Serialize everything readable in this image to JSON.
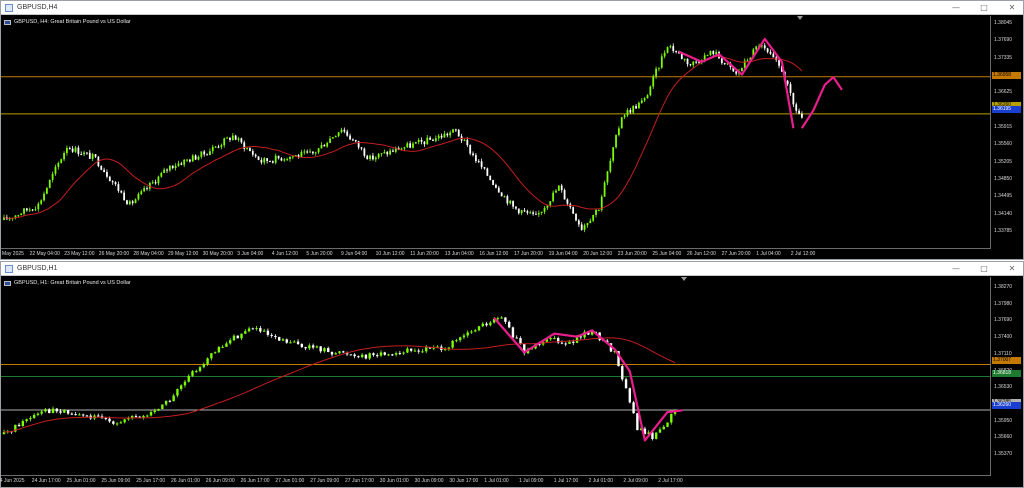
{
  "colors": {
    "bull": "#7CFC00",
    "bear": "#FFFFFF",
    "ma": "#C41E1E",
    "forecast": "#E91E8C",
    "hline_orange": "#C47A00",
    "hline_yellow": "#B8A000",
    "hline_green": "#1E7A2E",
    "hline_grey": "#B0B0B0"
  },
  "windows": [
    {
      "id": "h4",
      "title": "GBPUSD,H4",
      "label": "GBPUSD, H4:  Great Britain Pound vs US Dollar",
      "window_buttons": [
        "—",
        "□",
        "✕"
      ],
      "y_ticks": [
        "1.38045",
        "1.37690",
        "1.37335",
        "1.36980",
        "1.36625",
        "1.36270",
        "1.35915",
        "1.35560",
        "1.35205",
        "1.34850",
        "1.34495",
        "1.34140",
        "1.33785"
      ],
      "price_labels": [
        {
          "text": "1.36958",
          "bg": "#C47A00",
          "fg": "#000000"
        },
        {
          "text": "1.36260",
          "bg": "#B8A000",
          "fg": "#000000"
        },
        {
          "text": "1.36195",
          "bg": "#1A3FD0",
          "fg": "#FFFFFF"
        }
      ],
      "x_ticks": [
        "21 May 2025",
        "22 May 04:00",
        "23 May 12:00",
        "26 May 20:00",
        "28 May 04:00",
        "29 May 12:00",
        "30 May 20:00",
        "3 Jun 04:00",
        "4 Jun 12:00",
        "5 Jun 20:00",
        "9 Jun 04:00",
        "10 Jun 12:00",
        "11 Jun 20:00",
        "13 Jun 04:00",
        "16 Jun 12:00",
        "17 Jun 20:00",
        "19 Jun 04:00",
        "20 Jun 12:00",
        "23 Jun 20:00",
        "25 Jun 04:00",
        "26 Jun 12:00",
        "27 Jun 20:00",
        "1 Jul 04:00",
        "2 Jul 12:00"
      ],
      "chart_data": {
        "type": "candlestick",
        "ylim": [
          1.336,
          1.3815
        ],
        "hlines": [
          {
            "price": 1.36958,
            "color": "hline_orange"
          },
          {
            "price": 1.3623,
            "color": "hline_yellow"
          }
        ],
        "waypoints": [
          [
            0,
            1.3415
          ],
          [
            12,
            1.3445
          ],
          [
            22,
            1.356
          ],
          [
            32,
            1.3535
          ],
          [
            44,
            1.3445
          ],
          [
            58,
            1.352
          ],
          [
            70,
            1.3545
          ],
          [
            80,
            1.358
          ],
          [
            90,
            1.353
          ],
          [
            100,
            1.354
          ],
          [
            108,
            1.3545
          ],
          [
            118,
            1.3595
          ],
          [
            128,
            1.3535
          ],
          [
            138,
            1.3555
          ],
          [
            148,
            1.357
          ],
          [
            158,
            1.359
          ],
          [
            168,
            1.351
          ],
          [
            178,
            1.344
          ],
          [
            186,
            1.342
          ],
          [
            194,
            1.348
          ],
          [
            202,
            1.34
          ],
          [
            208,
            1.344
          ],
          [
            216,
            1.362
          ],
          [
            224,
            1.365
          ],
          [
            232,
            1.376
          ],
          [
            240,
            1.372
          ],
          [
            248,
            1.3745
          ],
          [
            256,
            1.37
          ],
          [
            264,
            1.376
          ],
          [
            272,
            1.371
          ],
          [
            276,
            1.364
          ],
          [
            279,
            1.3615
          ]
        ],
        "ma_period": 20,
        "forecast": [
          [
            279,
            1.3595
          ],
          [
            283,
            1.363
          ],
          [
            287,
            1.368
          ],
          [
            290,
            1.3695
          ],
          [
            293,
            1.367
          ]
        ],
        "zigzag": [
          [
            236,
            1.3745
          ],
          [
            244,
            1.3725
          ],
          [
            250,
            1.374
          ],
          [
            258,
            1.37
          ],
          [
            266,
            1.377
          ],
          [
            272,
            1.3725
          ],
          [
            276,
            1.3595
          ]
        ]
      }
    },
    {
      "id": "h1",
      "title": "GBPUSD,H1",
      "label": "GBPUSD, H1:  Great Britain Pound vs US Dollar",
      "window_buttons": [
        "—",
        "□",
        "✕"
      ],
      "y_ticks": [
        "1.38270",
        "1.37980",
        "1.37690",
        "1.37400",
        "1.37110",
        "1.36820",
        "1.36530",
        "1.36240",
        "1.35950",
        "1.35660",
        "1.35370"
      ],
      "price_labels": [
        {
          "text": "1.37007",
          "bg": "#C47A00",
          "fg": "#000000"
        },
        {
          "text": "1.36818",
          "bg": "#1E7A2E",
          "fg": "#FFFFFF"
        },
        {
          "text": "1.36285",
          "bg": "#B0B0B0",
          "fg": "#000000"
        },
        {
          "text": "1.36260",
          "bg": "#1A3FD0",
          "fg": "#FFFFFF"
        }
      ],
      "x_ticks": [
        "24 Jun 2025",
        "24 Jun 17:00",
        "25 Jun 01:00",
        "25 Jun 09:00",
        "25 Jun 17:00",
        "26 Jun 01:00",
        "26 Jun 09:00",
        "26 Jun 17:00",
        "27 Jun 01:00",
        "27 Jun 09:00",
        "27 Jun 17:00",
        "30 Jun 01:00",
        "30 Jun 09:00",
        "30 Jun 17:00",
        "1 Jul 01:00",
        "1 Jul 09:00",
        "1 Jul 17:00",
        "2 Jul 01:00",
        "2 Jul 09:00",
        "2 Jul 17:00"
      ],
      "chart_data": {
        "type": "candlestick",
        "ylim": [
          1.3525,
          1.384
        ],
        "hlines": [
          {
            "price": 1.37007,
            "color": "hline_orange"
          },
          {
            "price": 1.36818,
            "color": "hline_green"
          },
          {
            "price": 1.36285,
            "color": "hline_grey"
          }
        ],
        "waypoints": [
          [
            0,
            1.359
          ],
          [
            10,
            1.363
          ],
          [
            20,
            1.362
          ],
          [
            30,
            1.361
          ],
          [
            38,
            1.362
          ],
          [
            44,
            1.3645
          ],
          [
            52,
            1.37
          ],
          [
            60,
            1.374
          ],
          [
            66,
            1.376
          ],
          [
            72,
            1.374
          ],
          [
            80,
            1.373
          ],
          [
            88,
            1.372
          ],
          [
            96,
            1.3715
          ],
          [
            104,
            1.372
          ],
          [
            112,
            1.3725
          ],
          [
            118,
            1.373
          ],
          [
            126,
            1.376
          ],
          [
            132,
            1.3775
          ],
          [
            138,
            1.372
          ],
          [
            144,
            1.3745
          ],
          [
            150,
            1.3735
          ],
          [
            156,
            1.3755
          ],
          [
            162,
            1.372
          ],
          [
            168,
            1.36
          ],
          [
            172,
            1.3585
          ],
          [
            178,
            1.3625
          ]
        ],
        "ma_period": 50,
        "forecast": [],
        "zigzag": [
          [
            130,
            1.3775
          ],
          [
            138,
            1.372
          ],
          [
            146,
            1.375
          ],
          [
            152,
            1.3745
          ],
          [
            156,
            1.3755
          ],
          [
            162,
            1.3725
          ],
          [
            166,
            1.369
          ],
          [
            170,
            1.358
          ],
          [
            176,
            1.3625
          ],
          [
            180,
            1.3628
          ]
        ]
      }
    }
  ]
}
